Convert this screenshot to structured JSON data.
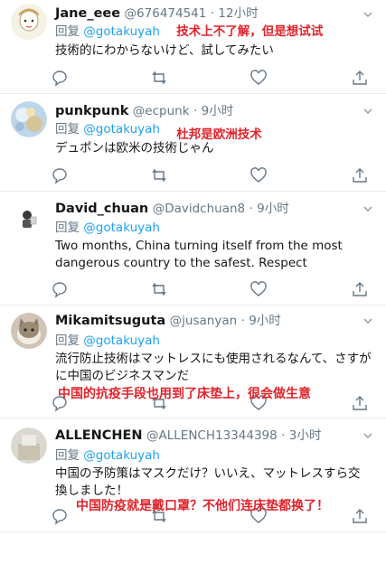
{
  "colors": {
    "accent": "#1da1f2",
    "annotation": "#e0242b",
    "muted": "#657786",
    "divider": "#e6ecf0"
  },
  "icons": {
    "reply": "reply-icon",
    "retweet": "retweet-icon",
    "like": "heart-icon",
    "share": "share-icon",
    "menu": "chevron-down-icon"
  },
  "tweets": [
    {
      "name": "Jane_eee",
      "handle": "@676474541",
      "time": "· 12小时",
      "reply_prefix": "回复",
      "reply_to": "@gotakuyah",
      "note": "技术上不了解，但是想试试",
      "text": "技術的にわからないけど、試してみたい"
    },
    {
      "name": "punkpunk",
      "handle": "@ecpunk",
      "time": "· 9小时",
      "reply_prefix": "回复",
      "reply_to": "@gotakuyah",
      "note": "杜邦是欧洲技术",
      "text": "デュポンは欧米の技術じゃん"
    },
    {
      "name": "David_chuan",
      "handle": "@Davidchuan8",
      "time": "· 9小时",
      "reply_prefix": "回复",
      "reply_to": "@gotakuyah",
      "note": "",
      "text": "Two months, China turning itself from the most dangerous country to the safest. Respect"
    },
    {
      "name": "Mikamitsuguta",
      "handle": "@jusanyan",
      "time": "· 9小时",
      "reply_prefix": "回复",
      "reply_to": "@gotakuyah",
      "note": "",
      "text": "流行防止技術はマットレスにも使用されるなんて、さすがに中国のビジネスマンだ",
      "overlay": "中国的抗疫手段也用到了床垫上，很会做生意"
    },
    {
      "name": "ALLENCHEN",
      "handle": "@ALLENCH13344398",
      "time": "· 3小时",
      "reply_prefix": "回复",
      "reply_to": "@gotakuyah",
      "note": "",
      "text": "中国の予防策はマスクだけ？いいえ、マットレスすら交換しました！",
      "overlay": "中国防疫就是戴口罩？不他们连床垫都换了！"
    }
  ]
}
